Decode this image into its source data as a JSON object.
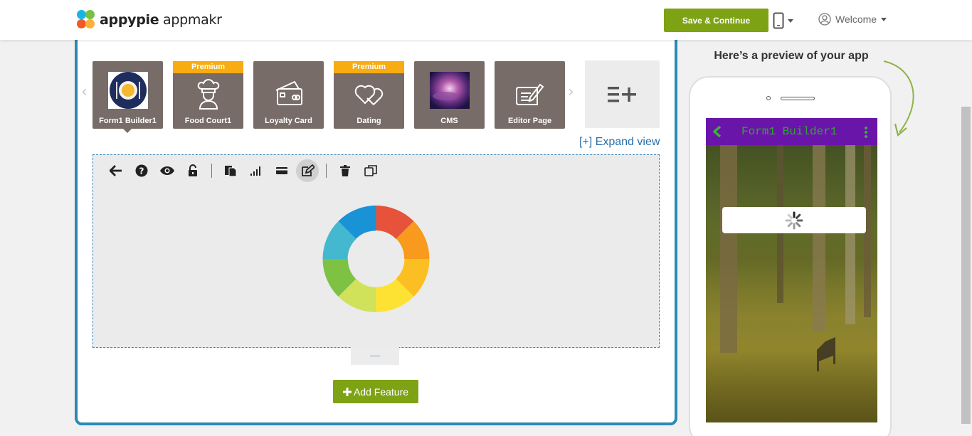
{
  "header": {
    "logo_bold": "appypie",
    "logo_light": " appmakr",
    "save_label": "Save & Continue",
    "device_icon": "mobile-phone-icon",
    "user_icon": "user-circle-icon",
    "welcome_label": "Welcome"
  },
  "pages": [
    {
      "label": "Form1 Builder1",
      "premium": "",
      "icon": "food-plate-image",
      "active": true
    },
    {
      "label": "Food Court1",
      "premium": "Premium",
      "icon": "chef-icon"
    },
    {
      "label": "Loyalty Card",
      "premium": "",
      "icon": "card-icon"
    },
    {
      "label": "Dating",
      "premium": "Premium",
      "icon": "hearts-icon"
    },
    {
      "label": "CMS",
      "premium": "",
      "icon": "galaxy-image"
    },
    {
      "label": "Editor Page",
      "premium": "",
      "icon": "edit-document-icon"
    }
  ],
  "expand_label": "[+] Expand view",
  "toolbar": {
    "tools": [
      "back-arrow-icon",
      "help-icon",
      "preview-eye-icon",
      "lock-icon",
      "copy-pages-icon",
      "signal-bars-icon",
      "card-icon",
      "edit-icon",
      "delete-icon",
      "duplicate-icon"
    ],
    "active_tool": "edit-icon"
  },
  "add_feature_label": "Add Feature",
  "preview": {
    "title": "Here’s a preview of your app",
    "app_title": "Form1 Builder1"
  },
  "colors": {
    "accent_green": "#7da314",
    "panel_border": "#2a8ab5",
    "tile_bg": "#776c68",
    "premium": "#f7ac12",
    "app_bar": "#6a15a9"
  }
}
